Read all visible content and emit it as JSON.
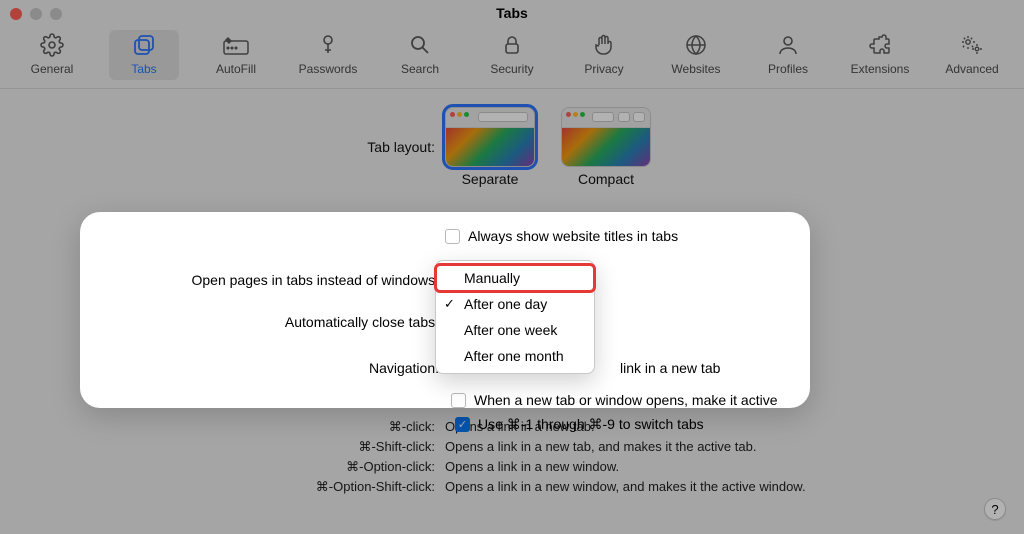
{
  "window": {
    "title": "Tabs"
  },
  "toolbar": {
    "items": [
      {
        "id": "general",
        "label": "General"
      },
      {
        "id": "tabs",
        "label": "Tabs",
        "selected": true
      },
      {
        "id": "autofill",
        "label": "AutoFill"
      },
      {
        "id": "passwords",
        "label": "Passwords"
      },
      {
        "id": "search",
        "label": "Search"
      },
      {
        "id": "security",
        "label": "Security"
      },
      {
        "id": "privacy",
        "label": "Privacy"
      },
      {
        "id": "websites",
        "label": "Websites"
      },
      {
        "id": "profiles",
        "label": "Profiles"
      },
      {
        "id": "extensions",
        "label": "Extensions"
      },
      {
        "id": "advanced",
        "label": "Advanced"
      }
    ]
  },
  "tab_layout": {
    "label": "Tab layout:",
    "options": {
      "separate": "Separate",
      "compact": "Compact"
    },
    "selected": "separate",
    "always_show_titles": {
      "label": "Always show website titles in tabs",
      "checked": false
    }
  },
  "open_pages": {
    "label": "Open pages in tabs instead of windows:"
  },
  "auto_close": {
    "label": "Automatically close tabs:",
    "options": [
      "Manually",
      "After one day",
      "After one week",
      "After one month"
    ],
    "highlighted": "Manually",
    "checked": "After one day"
  },
  "navigation": {
    "label": "Navigation:",
    "link_new_tab_suffix": "link in a new tab",
    "active_on_open": {
      "label": "When a new tab or window opens, make it active",
      "checked": false
    },
    "cmd_switch": {
      "label": "Use ⌘-1 through ⌘-9 to switch tabs",
      "checked": true
    }
  },
  "shortcuts": [
    {
      "key": "⌘-click:",
      "desc": "Opens a link in a new tab."
    },
    {
      "key": "⌘-Shift-click:",
      "desc": "Opens a link in a new tab, and makes it the active tab."
    },
    {
      "key": "⌘-Option-click:",
      "desc": "Opens a link in a new window."
    },
    {
      "key": "⌘-Option-Shift-click:",
      "desc": "Opens a link in a new window, and makes it the active window."
    }
  ],
  "help": "?"
}
